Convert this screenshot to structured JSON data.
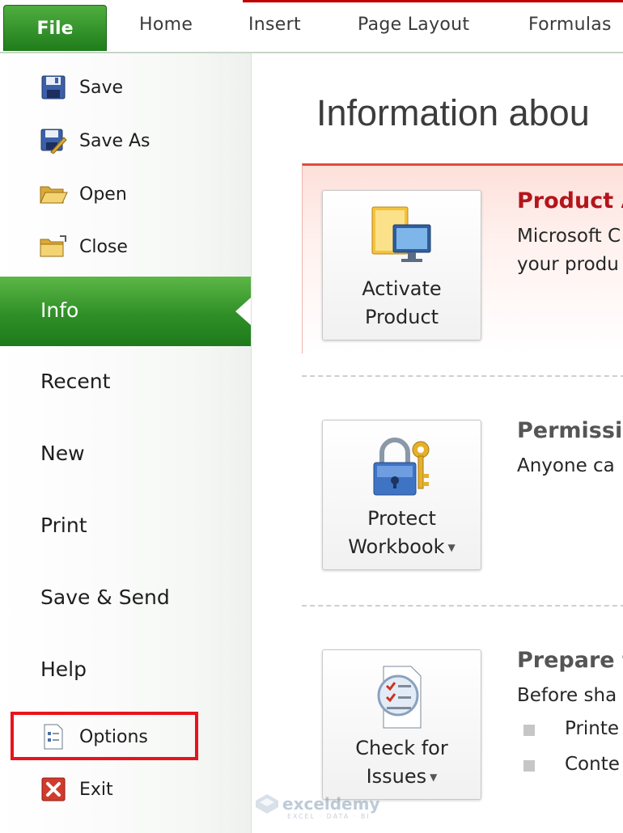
{
  "ribbon": {
    "file_label": "File",
    "tabs": [
      "Home",
      "Insert",
      "Page Layout",
      "Formulas"
    ]
  },
  "nav": {
    "commands": [
      {
        "label": "Save",
        "icon": "floppy-disk-icon"
      },
      {
        "label": "Save As",
        "icon": "save-as-icon"
      },
      {
        "label": "Open",
        "icon": "open-folder-icon"
      },
      {
        "label": "Close",
        "icon": "close-folder-icon"
      }
    ],
    "active_tab": "Info",
    "tabs": [
      "Recent",
      "New",
      "Print",
      "Save & Send",
      "Help"
    ],
    "options_label": "Options",
    "exit_label": "Exit",
    "highlight_color": "#e8141c"
  },
  "main": {
    "title": "Information abou",
    "sections": [
      {
        "button_lines": [
          "Activate",
          "Product"
        ],
        "heading": "Product A",
        "text_lines": [
          "Microsoft C",
          "your produ"
        ]
      },
      {
        "button_lines": [
          "Protect",
          "Workbook"
        ],
        "heading": "Permissio",
        "text_lines": [
          "Anyone ca"
        ]
      },
      {
        "button_lines": [
          "Check for",
          "Issues"
        ],
        "heading": "Prepare f",
        "text_lines": [
          "Before sha"
        ],
        "bullets": [
          "Printe",
          "Conte"
        ]
      }
    ]
  },
  "watermark": {
    "name": "exceldemy",
    "tagline": "EXCEL · DATA · BI"
  }
}
